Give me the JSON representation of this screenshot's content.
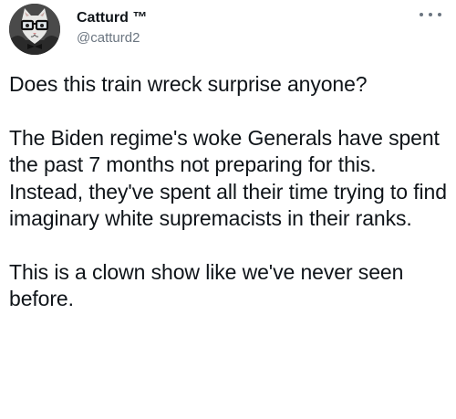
{
  "tweet": {
    "display_name": "Catturd ™",
    "handle": "@catturd2",
    "more_icon": "ellipsis-icon",
    "avatar_icon": "cat-with-glasses-avatar",
    "paragraphs": [
      "Does this train wreck surprise anyone?",
      "The Biden regime's woke Generals have spent the past 7 months not preparing for this. Instead, they've spent all their time trying to find imaginary white supremacists in their ranks.",
      "This is a clown show like we've never seen before."
    ]
  }
}
